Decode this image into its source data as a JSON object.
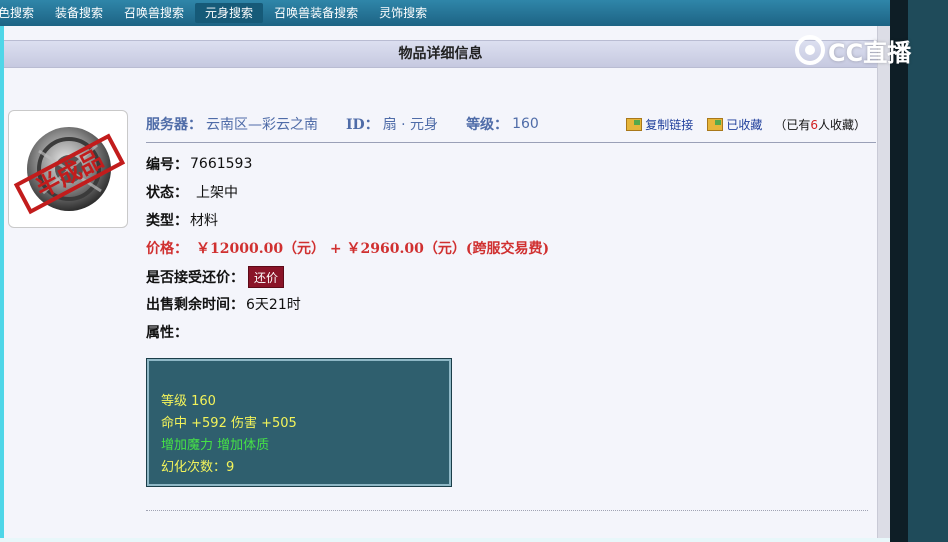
{
  "nav": {
    "items": [
      {
        "label": "色搜索"
      },
      {
        "label": "装备搜索"
      },
      {
        "label": "召唤兽搜索"
      },
      {
        "label": "元身搜索"
      },
      {
        "label": "召唤兽装备搜索"
      },
      {
        "label": "灵饰搜索"
      }
    ],
    "active_index": 3
  },
  "watermark": {
    "text": "CC直播"
  },
  "page": {
    "title": "物品详细信息"
  },
  "item_image": {
    "stamp_text": "半成品"
  },
  "header": {
    "server_label": "服务器：",
    "server_value": "云南区—彩云之南",
    "id_label": "ID：",
    "id_value": "扇 · 元身",
    "level_label": "等级：",
    "level_value": "160",
    "copy_link": "复制链接",
    "favorited": "已收藏",
    "fav_prefix": "（已有",
    "fav_count": "6",
    "fav_suffix": "人收藏）"
  },
  "details": {
    "number_label": "编号：",
    "number_value": "7661593",
    "status_label": "状态：",
    "status_value": "上架中",
    "type_label": "类型：",
    "type_value": "材料",
    "price_label": "价格：",
    "price_value": "￥12000.00（元） + ￥2960.00（元）(跨服交易费)",
    "counter_label": "是否接受还价：",
    "counter_button": "还价",
    "time_label": "出售剩余时间：",
    "time_value": "6天21时",
    "attr_label": "属性："
  },
  "attributes": {
    "level_line": "等级 160",
    "stats_line": "命中 +592 伤害 +505",
    "bonus_line": "增加魔力 增加体质",
    "transform_line": "幻化次数：9"
  },
  "colors": {
    "nav_bg": "#1d6384",
    "attr_box_bg": "#2f5f6e",
    "price_red": "#d03030",
    "counter_button_bg": "#8a1428"
  }
}
